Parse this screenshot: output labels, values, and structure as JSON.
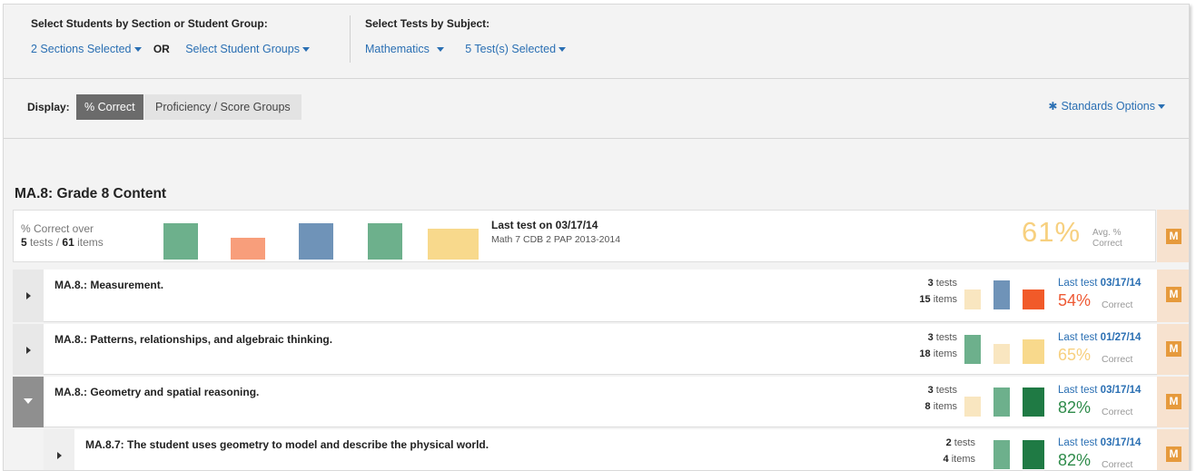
{
  "selectors": {
    "students_label": "Select Students by Section or Student Group:",
    "sections_link": "2 Sections Selected",
    "or_text": "OR",
    "groups_link": "Select Student Groups",
    "tests_label": "Select Tests by Subject:",
    "subject_link": "Mathematics",
    "tests_link": "5 Test(s) Selected"
  },
  "display": {
    "label": "Display:",
    "pct_correct_button": "% Correct",
    "proficiency_button": "Proficiency / Score Groups",
    "standards_options": "Standards Options"
  },
  "section": {
    "title": "MA.8: Grade 8 Content",
    "summary": {
      "pct_correct_over": "% Correct over",
      "tests_num": "5",
      "tests_word": "tests /",
      "items_num": "61",
      "items_word": "items",
      "bars": [
        {
          "color": "#6db08c",
          "level": 1.0
        },
        {
          "color": "#f89e7b",
          "level": 0.6
        },
        {
          "color": "#6f93b8",
          "level": 1.0
        },
        {
          "color": "#6db08c",
          "level": 1.0
        },
        {
          "color": "#f8d98c",
          "level": 0.85
        }
      ],
      "last_test": "Last test on 03/17/14",
      "last_test_name": "Math 7 CDB 2 PAP 2013-2014",
      "avg_pct": "61%",
      "avg_label_1": "Avg. %",
      "avg_label_2": "Correct",
      "badge": "M"
    },
    "rows": [
      {
        "title": "MA.8.: Measurement.",
        "expanded": false,
        "indent": 0,
        "tests_num": "3",
        "tests_word": "tests",
        "items_num": "15",
        "items_word": "items",
        "bars": [
          {
            "color": "#f9e6c0",
            "level": 0.7
          },
          {
            "color": "#6f93b8",
            "level": 1.0
          },
          {
            "color": "#f15a29",
            "level": 0.7
          }
        ],
        "last_label": "Last test",
        "last_date": "03/17/14",
        "pct": "54%",
        "pct_color": "#ee5a35",
        "correct": "Correct",
        "badge": "M"
      },
      {
        "title": "MA.8.: Patterns, relationships, and algebraic thinking.",
        "expanded": false,
        "indent": 0,
        "tests_num": "3",
        "tests_word": "tests",
        "items_num": "18",
        "items_word": "items",
        "bars": [
          {
            "color": "#6db08c",
            "level": 1.0
          },
          {
            "color": "#f9e6c0",
            "level": 0.7
          },
          {
            "color": "#f8d98c",
            "level": 0.85
          }
        ],
        "last_label": "Last test",
        "last_date": "01/27/14",
        "pct": "65%",
        "pct_color": "#f7d07f",
        "correct": "Correct",
        "badge": "M"
      },
      {
        "title": "MA.8.: Geometry and spatial reasoning.",
        "expanded": true,
        "indent": 0,
        "tests_num": "3",
        "tests_word": "tests",
        "items_num": "8",
        "items_word": "items",
        "bars": [
          {
            "color": "#f9e6c0",
            "level": 0.7
          },
          {
            "color": "#6db08c",
            "level": 1.0
          },
          {
            "color": "#1f7a44",
            "level": 1.0
          }
        ],
        "last_label": "Last test",
        "last_date": "03/17/14",
        "pct": "82%",
        "pct_color": "#2e8b4a",
        "correct": "Correct",
        "badge": "M"
      },
      {
        "title": "MA.8.7: The student uses geometry to model and describe the physical world.",
        "expanded": false,
        "indent": 1,
        "tests_num": "2",
        "tests_word": "tests",
        "items_num": "4",
        "items_word": "items",
        "bars": [
          {
            "color": "#6db08c",
            "level": 1.0
          },
          {
            "color": "#1f7a44",
            "level": 1.0
          }
        ],
        "last_label": "Last test",
        "last_date": "03/17/14",
        "pct": "82%",
        "pct_color": "#2e8b4a",
        "correct": "Correct",
        "badge": "M"
      }
    ]
  }
}
